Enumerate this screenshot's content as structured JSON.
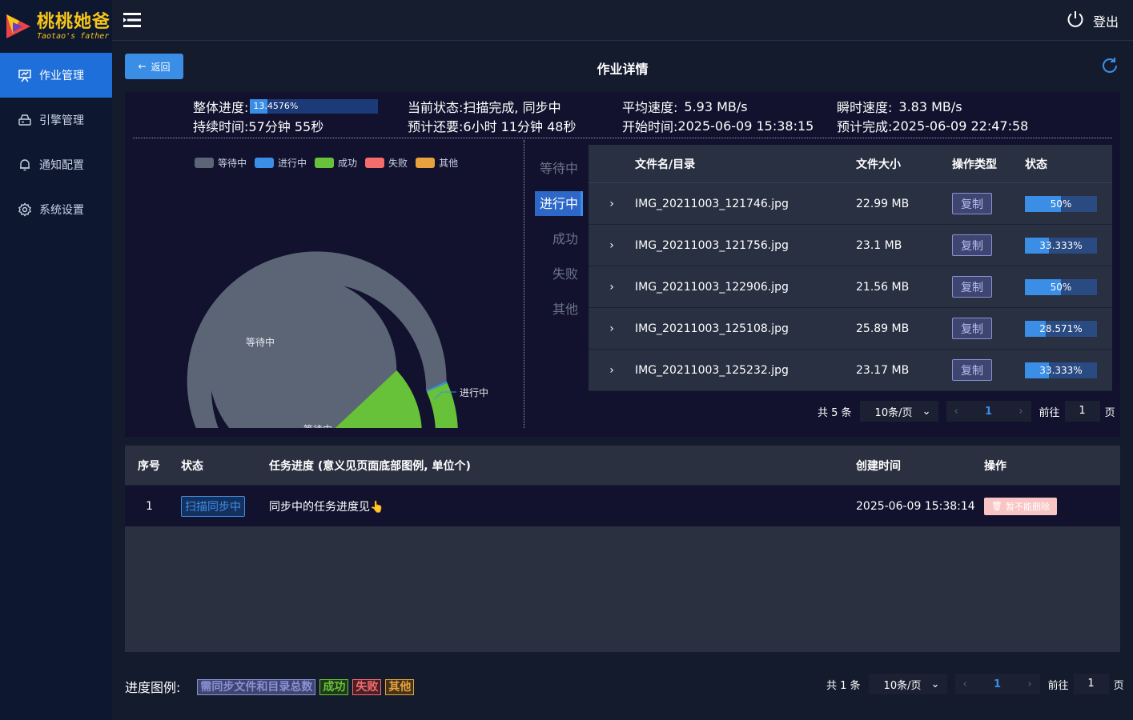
{
  "app": {
    "title": "桃桃她爸",
    "subtitle": "Taotao's father"
  },
  "sidebar": {
    "items": [
      {
        "label": "作业管理",
        "icon": "presentation-icon",
        "active": true
      },
      {
        "label": "引擎管理",
        "icon": "server-icon",
        "active": false
      },
      {
        "label": "通知配置",
        "icon": "bell-icon",
        "active": false
      },
      {
        "label": "系统设置",
        "icon": "gear-icon",
        "active": false
      }
    ]
  },
  "topbar": {
    "logout_label": "登出"
  },
  "page": {
    "back_label": "返回",
    "title": "作业详情"
  },
  "stats": {
    "overall_progress_label": "整体进度:",
    "overall_progress_value": "13.4576%",
    "overall_progress_fraction": 0.134576,
    "current_status_label": "当前状态:",
    "current_status_value": "扫描完成, 同步中",
    "avg_speed_label": "平均速度:",
    "avg_speed_value": "5.93 MB/s",
    "instant_speed_label": "瞬时速度:",
    "instant_speed_value": "3.83 MB/s",
    "duration_label": "持续时间:",
    "duration_value": "57分钟 55秒",
    "remaining_label": "预计还要:",
    "remaining_value": "6小时 11分钟 48秒",
    "start_label": "开始时间:",
    "start_value": "2025-06-09 15:38:15",
    "eta_label": "预计完成:",
    "eta_value": "2025-06-09 22:47:58"
  },
  "chart_data": {
    "type": "pie",
    "legend": [
      "等待中",
      "进行中",
      "成功",
      "失败",
      "其他"
    ],
    "colors": [
      "#5b6576",
      "#3a8ee6",
      "#67c23a",
      "#f56c6c",
      "#e6a23c"
    ],
    "outer_ring": {
      "categories": [
        "等待中",
        "进行中",
        "成功",
        "失败",
        "其他"
      ],
      "values": [
        86.5,
        0.5,
        13,
        0,
        0
      ]
    },
    "inner_ring": {
      "categories": [
        "等待中",
        "成功"
      ],
      "values": [
        76,
        24
      ]
    },
    "labels": {
      "outer": [
        "等待中",
        "进行中",
        "成功",
        "失败",
        "其他"
      ],
      "inner": [
        "等待中",
        "成功"
      ]
    }
  },
  "tabs": [
    {
      "label": "等待中",
      "active": false
    },
    {
      "label": "进行中",
      "active": true
    },
    {
      "label": "成功",
      "active": false
    },
    {
      "label": "失败",
      "active": false
    },
    {
      "label": "其他",
      "active": false
    }
  ],
  "file_table": {
    "headers": {
      "name": "文件名/目录",
      "size": "文件大小",
      "op": "操作类型",
      "status": "状态"
    },
    "rows": [
      {
        "name": "IMG_20211003_121746.jpg",
        "size": "22.99 MB",
        "op": "复制",
        "progress": "50%",
        "fraction": 0.5
      },
      {
        "name": "IMG_20211003_121756.jpg",
        "size": "23.1 MB",
        "op": "复制",
        "progress": "33.333%",
        "fraction": 0.33333
      },
      {
        "name": "IMG_20211003_122906.jpg",
        "size": "21.56 MB",
        "op": "复制",
        "progress": "50%",
        "fraction": 0.5
      },
      {
        "name": "IMG_20211003_125108.jpg",
        "size": "25.89 MB",
        "op": "复制",
        "progress": "28.571%",
        "fraction": 0.28571
      },
      {
        "name": "IMG_20211003_125232.jpg",
        "size": "23.17 MB",
        "op": "复制",
        "progress": "33.333%",
        "fraction": 0.33333
      }
    ]
  },
  "file_pager": {
    "total": "共 5 条",
    "page_size": "10条/页",
    "current_page": "1",
    "goto_label": "前往",
    "goto_value": "1",
    "page_suffix": "页"
  },
  "task_table": {
    "headers": {
      "no": "序号",
      "status": "状态",
      "progress": "任务进度 (意义见页面底部图例, 单位个)",
      "created": "创建时间",
      "op": "操作"
    },
    "rows": [
      {
        "no": "1",
        "status": "扫描同步中",
        "progress": "同步中的任务进度见👆",
        "created": "2025-06-09 15:38:14",
        "op": "暂不能删除"
      }
    ]
  },
  "task_pager": {
    "total": "共 1 条",
    "page_size": "10条/页",
    "current_page": "1",
    "goto_label": "前往",
    "goto_value": "1",
    "page_suffix": "页"
  },
  "legend_bottom": {
    "label": "进度图例:",
    "tags": [
      {
        "text": "需同步文件和目录总数",
        "color": "#8b90d6",
        "bg": "#3e4670"
      },
      {
        "text": "成功",
        "color": "#67c23a",
        "bg": "#1f3a1a"
      },
      {
        "text": "失败",
        "color": "#f56c6c",
        "bg": "#4a1f26"
      },
      {
        "text": "其他",
        "color": "#e6a23c",
        "bg": "#45321a"
      }
    ]
  }
}
